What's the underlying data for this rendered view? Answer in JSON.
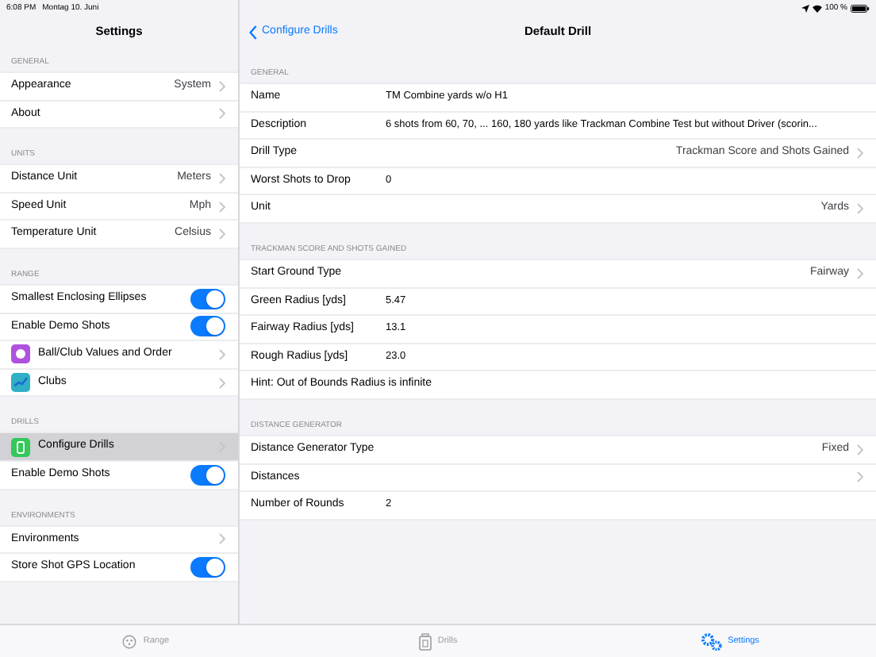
{
  "status_bar": {
    "time": "6:08 PM",
    "date": "Montag 10. Juni",
    "battery": "100 %"
  },
  "sidebar": {
    "title": "Settings",
    "sections": [
      {
        "header": "GENERAL",
        "rows": [
          {
            "kind": "value",
            "label": "Appearance",
            "value": "System",
            "selected": false
          },
          {
            "kind": "link",
            "label": "About",
            "selected": false
          }
        ]
      },
      {
        "header": "UNITS",
        "rows": [
          {
            "kind": "value",
            "label": "Distance Unit",
            "value": "Meters",
            "selected": false
          },
          {
            "kind": "value",
            "label": "Speed Unit",
            "value": "Mph",
            "selected": false
          },
          {
            "kind": "value",
            "label": "Temperature Unit",
            "value": "Celsius",
            "selected": false
          }
        ]
      },
      {
        "header": "RANGE",
        "rows": [
          {
            "kind": "toggle",
            "label": "Smallest Enclosing Ellipses",
            "on": true,
            "selected": false
          },
          {
            "kind": "toggle",
            "label": "Enable Demo Shots",
            "on": true,
            "selected": false
          },
          {
            "kind": "icon-link",
            "label": "Ball/Club Values and Order",
            "color": "#af52de",
            "selected": false
          },
          {
            "kind": "icon-link",
            "label": "Clubs",
            "color": "#30b0c7",
            "selected": false
          }
        ]
      },
      {
        "header": "DRILLS",
        "rows": [
          {
            "kind": "icon-link",
            "label": "Configure Drills",
            "color": "#34c759",
            "selected": true
          },
          {
            "kind": "toggle",
            "label": "Enable Demo Shots",
            "on": true,
            "selected": false
          }
        ]
      },
      {
        "header": "ENVIRONMENTS",
        "rows": [
          {
            "kind": "link",
            "label": "Environments",
            "selected": false
          },
          {
            "kind": "toggle",
            "label": "Store Shot GPS Location",
            "on": true,
            "selected": false
          }
        ]
      }
    ]
  },
  "detail": {
    "back": "Configure Drills",
    "title": "Default Drill",
    "sections": [
      {
        "header": "GENERAL",
        "rows": [
          {
            "kind": "field",
            "label": "Name",
            "value": "TM Combine yards w/o H1"
          },
          {
            "kind": "field",
            "label": "Description",
            "value": "6 shots from 60, 70, ... 160, 180 yards like Trackman Combine Test but without Driver (scorin..."
          },
          {
            "kind": "select",
            "label": "Drill Type",
            "value": "Trackman Score and Shots Gained"
          },
          {
            "kind": "field",
            "label": "Worst Shots to Drop",
            "value": "0"
          },
          {
            "kind": "select",
            "label": "Unit",
            "value": "Yards"
          }
        ]
      },
      {
        "header": "TRACKMAN SCORE AND SHOTS GAINED",
        "rows": [
          {
            "kind": "select",
            "label": "Start Ground Type",
            "value": "Fairway"
          },
          {
            "kind": "field",
            "label": "Green Radius [yds]",
            "value": "5.47"
          },
          {
            "kind": "field",
            "label": "Fairway Radius [yds]",
            "value": "13.1"
          },
          {
            "kind": "field",
            "label": "Rough Radius [yds]",
            "value": "23.0"
          },
          {
            "kind": "hint",
            "label": "Hint: Out of Bounds Radius is infinite"
          }
        ]
      },
      {
        "header": "DISTANCE GENERATOR",
        "rows": [
          {
            "kind": "select",
            "label": "Distance Generator Type",
            "value": "Fixed"
          },
          {
            "kind": "select",
            "label": "Distances"
          },
          {
            "kind": "field",
            "label": "Number of Rounds",
            "value": "2"
          }
        ]
      }
    ]
  },
  "tab_bar": [
    {
      "label": "Range",
      "selected": false
    },
    {
      "label": "Drills",
      "selected": false
    },
    {
      "label": "Settings",
      "selected": true
    }
  ]
}
